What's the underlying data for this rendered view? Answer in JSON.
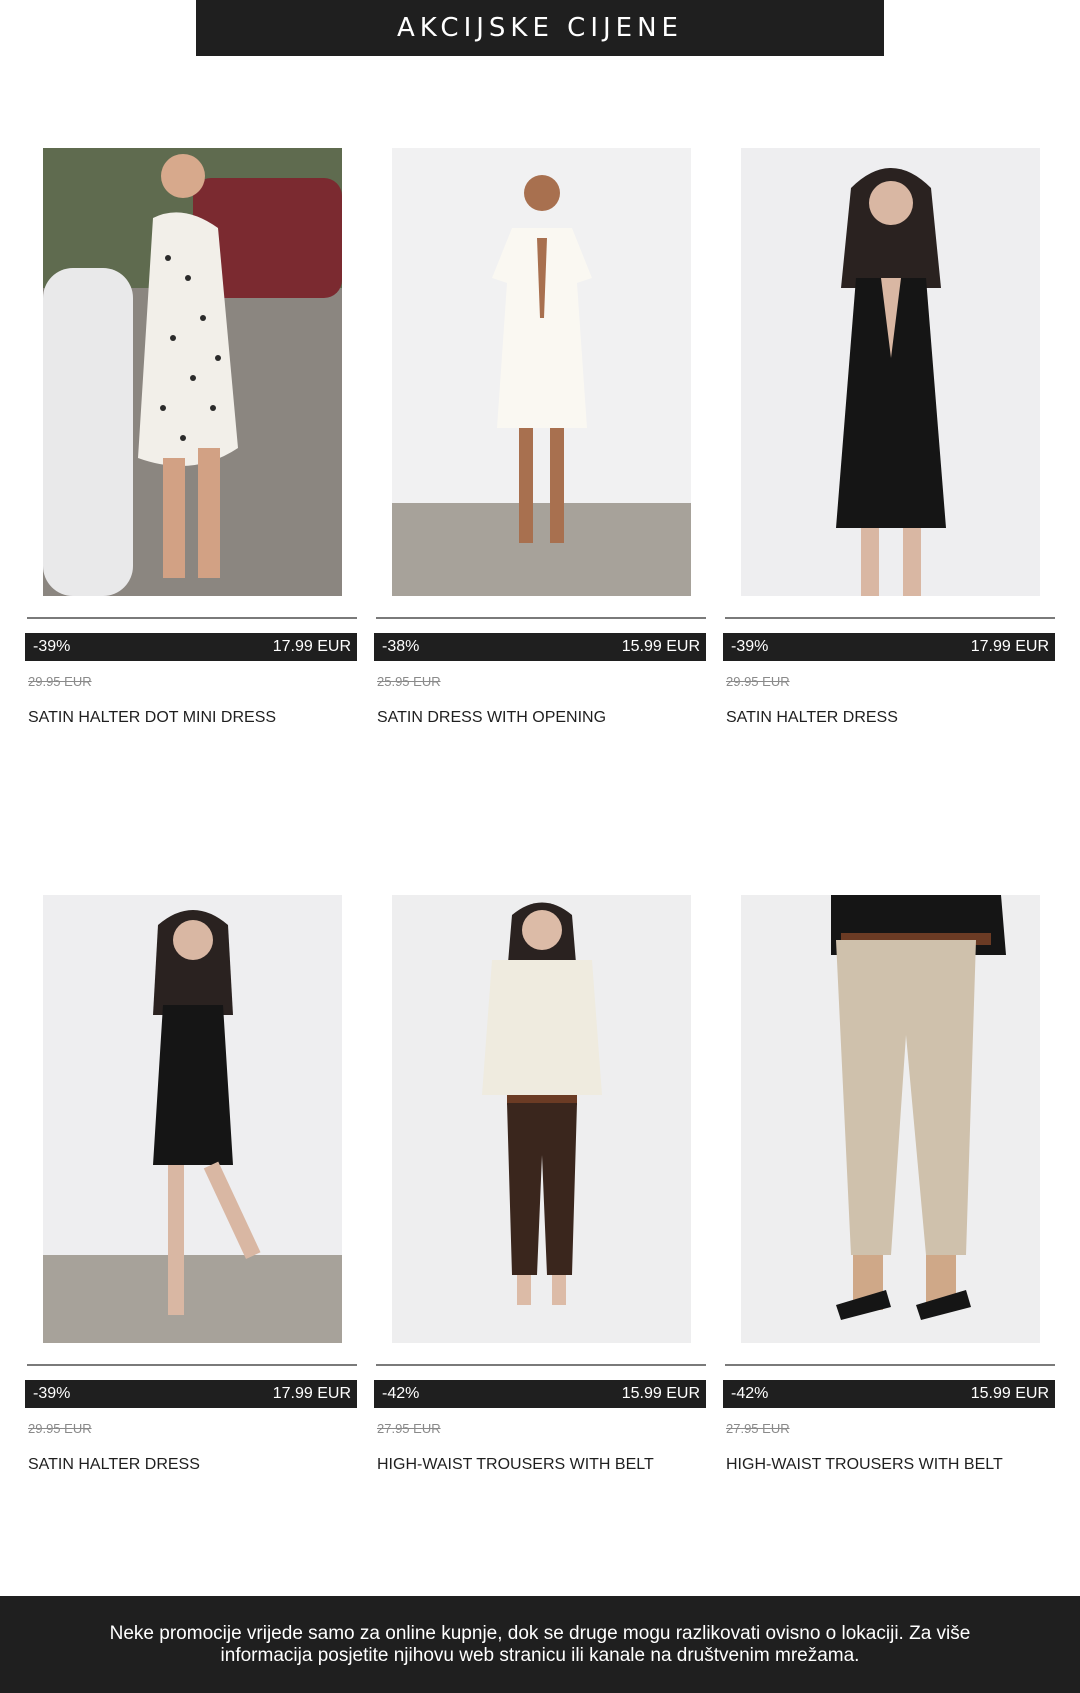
{
  "banner": {
    "title": "AKCIJSKE CIJENE"
  },
  "products": [
    {
      "discount": "-39%",
      "price": "17.99 EUR",
      "old_price": "29.95 EUR",
      "name": "SATIN HALTER DOT MINI DRESS"
    },
    {
      "discount": "-38%",
      "price": "15.99 EUR",
      "old_price": "25.95 EUR",
      "name": "SATIN DRESS WITH OPENING"
    },
    {
      "discount": "-39%",
      "price": "17.99 EUR",
      "old_price": "29.95 EUR",
      "name": "SATIN HALTER DRESS"
    },
    {
      "discount": "-39%",
      "price": "17.99 EUR",
      "old_price": "29.95 EUR",
      "name": "SATIN HALTER DRESS"
    },
    {
      "discount": "-42%",
      "price": "15.99 EUR",
      "old_price": "27.95 EUR",
      "name": "HIGH-WAIST TROUSERS WITH BELT"
    },
    {
      "discount": "-42%",
      "price": "15.99 EUR",
      "old_price": "27.95 EUR",
      "name": "HIGH-WAIST TROUSERS WITH BELT"
    }
  ],
  "footer": {
    "text": "Neke promocije vrijede samo za online kupnje, dok se druge mogu razlikovati ovisno o lokaciji. Za više informacija posjetite njihovu web stranicu ili kanale na društvenim mrežama."
  },
  "colors": {
    "dark": "#1f1f1f",
    "background": "#ffffff",
    "muted": "#8a8a8a"
  }
}
